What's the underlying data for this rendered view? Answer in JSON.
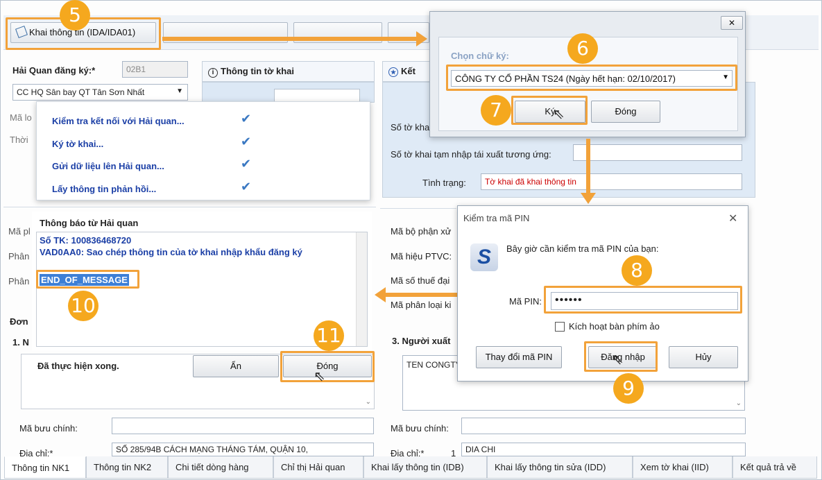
{
  "toolbar": {
    "khai_label": "Khai thông tin (IDA/IDA01)"
  },
  "steps": [
    "5",
    "6",
    "7",
    "8",
    "9",
    "10",
    "11"
  ],
  "form": {
    "hq_label": "Hải Quan đăng ký:*",
    "hq_code": "02B1",
    "hq_name": "CC HQ Sân bay QT Tân Sơn Nhất",
    "ma_label_short": "Mã lo",
    "thoi_label_short": "Thời",
    "info_panel_title": "Thông tin tờ khai",
    "result_panel_title": "Kết",
    "so_to_khai_label": "Số tờ kha",
    "so_to_khai_tam_label": "Số tờ khai tạm nhập tái xuất tương ứng:",
    "tinh_trang_label": "Tình trạng:",
    "tinh_trang_value": "Tờ khai đã khai thông tin",
    "ma_pl_short": "Mã pl",
    "phan_short_1": "Phân",
    "phan_short_2": "Phân",
    "don_short": "Đơn",
    "section1_short": "1. N",
    "ma_bo_phan_label": "Mã bộ phận xử",
    "ma_hieu_ptvc_label": "Mã hiệu PTVC:",
    "ma_so_thue_label": "Mã số thuế đại",
    "ma_phan_loai_label": "Mã phân loại ki",
    "nguoi_xuat_label": "3. Người xuất",
    "nguoi_xuat_value": "TEN CONGTY",
    "ma_buu_chinh_label_left": "Mã bưu chính:",
    "ma_buu_chinh_label_right": "Mã bưu chính:",
    "dia_chi_label_left": "Địa chỉ:*",
    "dia_chi_value_left": "SỐ 285/94B CÁCH MẠNG THÁNG TÁM, QUẬN 10,",
    "dia_chi_label_right": "Địa chỉ:*",
    "dia_chi_num_right": "1",
    "dia_chi_value_right": "DIA CHI"
  },
  "progress": {
    "items": [
      "Kiểm tra kết nối với Hải quan...",
      "Ký tờ khai...",
      "Gửi dữ liệu lên Hải quan...",
      "Lấy thông tin phản hồi..."
    ],
    "check_icon": "checkmark-icon"
  },
  "notice": {
    "title": "Thông báo từ Hải quan",
    "line1": "Số TK: 100836468720",
    "line2": "VAD0AA0: Sao chép thông tin của tờ khai nhập khẩu đăng ký",
    "end_message": "END_OF_MESSAGE",
    "done_text": "Đã thực hiện xong.",
    "hide_button": "Ẩn",
    "close_button": "Đóng"
  },
  "signature_dialog": {
    "close_glyph": "✕",
    "label": "Chọn chữ ký:",
    "selected": "CÔNG TY CỔ PHẦN TS24 (Ngày hết hạn: 02/10/2017)",
    "sign_button": "Ký",
    "close_button": "Đóng"
  },
  "pin_dialog": {
    "title": "Kiểm tra mã PIN",
    "close_glyph": "✕",
    "message": "Bây giờ cần kiểm tra mã PIN của bạn:",
    "pin_label": "Mã PIN:",
    "pin_value": "••••••",
    "virtual_keyboard_label": "Kích hoạt bàn phím ảo",
    "change_pin_button": "Thay đổi mã PIN",
    "login_button": "Đăng nhập",
    "cancel_button": "Hủy",
    "logo_letter": "S"
  },
  "tabs": [
    "Thông tin NK1",
    "Thông tin NK2",
    "Chi tiết dòng hàng",
    "Chỉ thị Hải quan",
    "Khai lấy thông tin (IDB)",
    "Khai lấy thông tin sửa (IDD)",
    "Xem tờ khai (IID)",
    "Kết quả trả về"
  ],
  "colors": {
    "highlight": "#f2a23a",
    "badge": "#f5a81e",
    "link_blue": "#1b3fa6",
    "status_red": "#cc0000"
  }
}
